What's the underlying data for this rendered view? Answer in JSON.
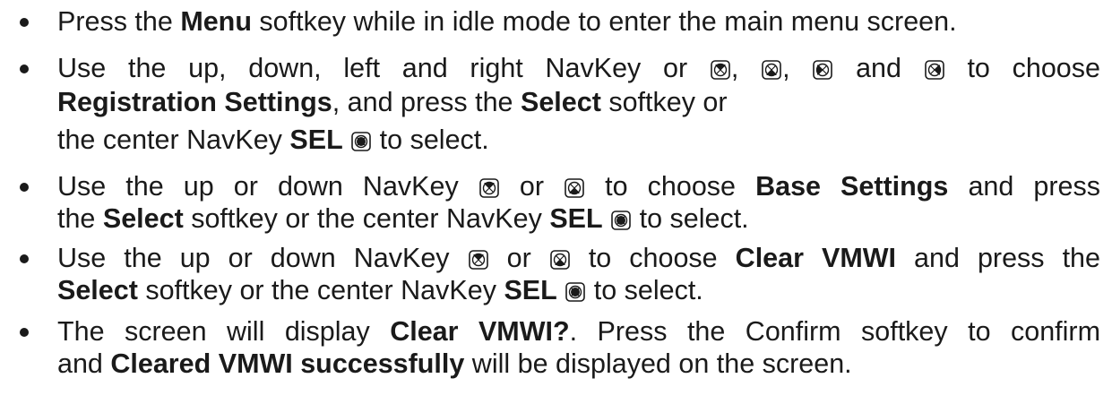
{
  "steps": [
    {
      "lines": [
        [
          {
            "t": "Press the "
          },
          {
            "t": "Menu",
            "b": true
          },
          {
            "t": " softkey while in idle mode to enter the main menu screen."
          }
        ]
      ]
    },
    {
      "lines": [
        [
          {
            "t": "Use the up, down, left and right NavKey or "
          },
          {
            "icon": "nav-up-icon"
          },
          {
            "t": ", "
          },
          {
            "icon": "nav-down-icon"
          },
          {
            "t": ", "
          },
          {
            "icon": "nav-left-icon"
          },
          {
            "t": " and "
          },
          {
            "icon": "nav-right-icon"
          },
          {
            "t": " to choose"
          }
        ],
        [
          {
            "t": "Registration Settings",
            "b": true
          },
          {
            "t": ", and press the "
          },
          {
            "t": "Select",
            "b": true
          },
          {
            "t": " softkey or"
          }
        ],
        [
          {
            "t": "the center NavKey "
          },
          {
            "t": "SEL",
            "b": true
          },
          {
            "t": " "
          },
          {
            "icon": "nav-select-icon"
          },
          {
            "t": " to select."
          }
        ]
      ]
    },
    {
      "lines": [
        [
          {
            "t": "Use the up or down NavKey "
          },
          {
            "icon": "nav-up-icon"
          },
          {
            "t": " or  "
          },
          {
            "icon": "nav-down-icon"
          },
          {
            "t": "  to choose "
          },
          {
            "t": "Base Settings",
            "b": true
          },
          {
            "t": " and press"
          }
        ],
        [
          {
            "t": "the "
          },
          {
            "t": "Select",
            "b": true
          },
          {
            "t": " softkey or the center NavKey "
          },
          {
            "t": "SEL",
            "b": true
          },
          {
            "t": " "
          },
          {
            "icon": "nav-select-icon"
          },
          {
            "t": " to select."
          }
        ]
      ]
    },
    {
      "lines": [
        [
          {
            "t": "Use the up or down NavKey "
          },
          {
            "icon": "nav-up-icon"
          },
          {
            "t": " or  "
          },
          {
            "icon": "nav-down-icon"
          },
          {
            "t": "  to choose "
          },
          {
            "t": "Clear VMWI",
            "b": true
          },
          {
            "t": " and press the"
          }
        ],
        [
          {
            "t": "Select",
            "b": true
          },
          {
            "t": " softkey or the center NavKey "
          },
          {
            "t": "SEL",
            "b": true
          },
          {
            "t": " "
          },
          {
            "icon": "nav-select-icon"
          },
          {
            "t": " to select."
          }
        ]
      ]
    },
    {
      "lines": [
        [
          {
            "t": "The screen will display "
          },
          {
            "t": "Clear VMWI?",
            "b": true
          },
          {
            "t": ". Press the Confirm softkey to confirm"
          }
        ],
        [
          {
            "t": "and "
          },
          {
            "t": "Cleared VMWI successfully",
            "b": true
          },
          {
            "t": " will be displayed on the screen."
          }
        ]
      ]
    }
  ]
}
